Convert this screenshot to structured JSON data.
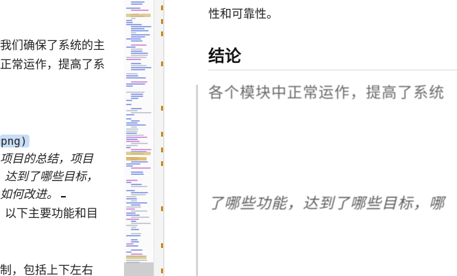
{
  "editor": {
    "lines": [
      {
        "id": "l1",
        "text": "我们确保了系统的主"
      },
      {
        "id": "l2",
        "text": "正常运作，提高了系"
      },
      {
        "id": "l3",
        "text": "png)"
      },
      {
        "id": "l4",
        "text": "项目的总结，项目"
      },
      {
        "id": "l5",
        "text": "达到了哪些目标，"
      },
      {
        "id": "l6",
        "text": "如何改进。"
      },
      {
        "id": "l7",
        "text": "以下主要功能和目"
      },
      {
        "id": "l8",
        "text": "制，包括上下左右"
      }
    ]
  },
  "preview": {
    "tail_text": "性和可靠性。",
    "heading": "结论",
    "image_text_top": "各个模块中正常运作，提高了系统",
    "image_text_middle": "了哪些功能，达到了哪些目标，哪"
  },
  "colors": {
    "selection_highlight": "#c8ddf6",
    "minimap_marker": "#c88a1a",
    "minimap_text_blue": "#3b5bdb",
    "minimap_text_purple": "#c040c0"
  }
}
